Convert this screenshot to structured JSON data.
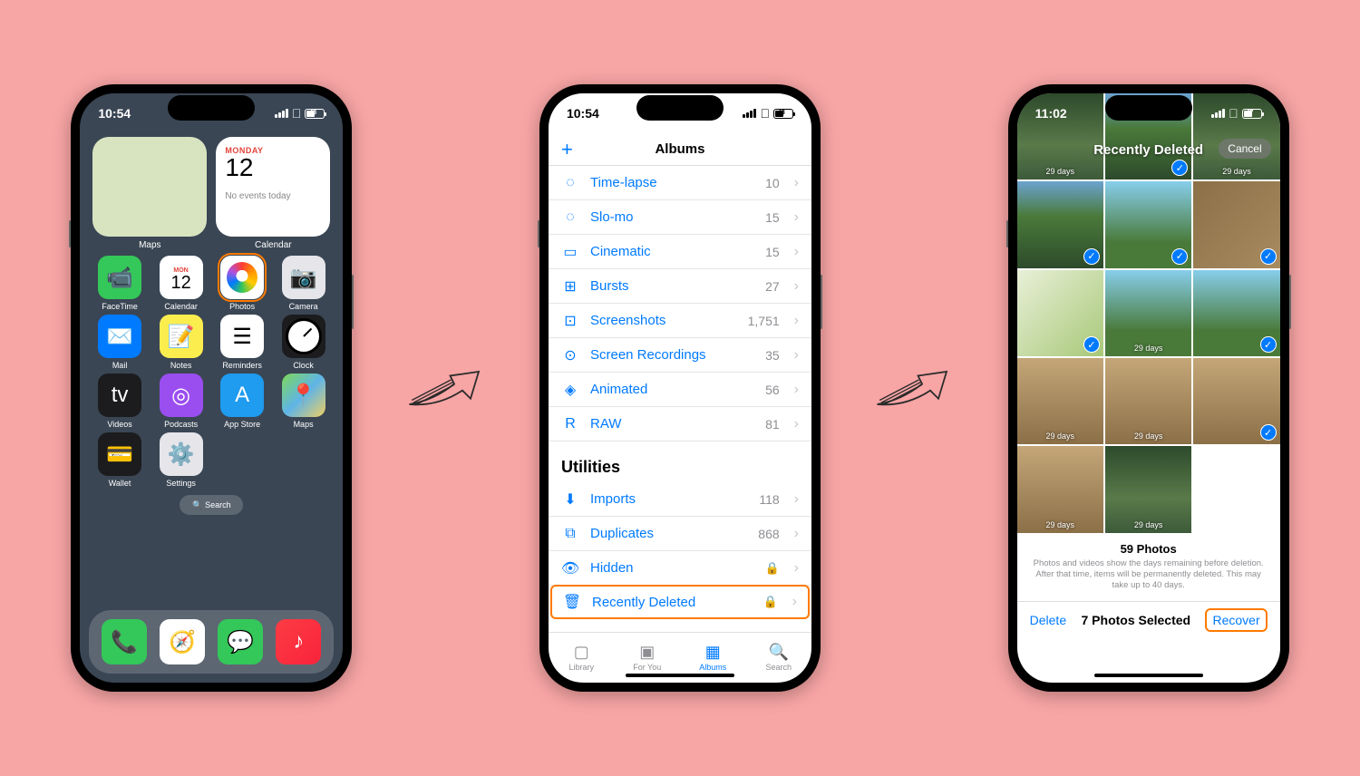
{
  "phone1": {
    "time": "10:54",
    "battery": "48",
    "widget_maps_label": "Maps",
    "widget_cal_label": "Calendar",
    "cal_day": "MONDAY",
    "cal_date": "12",
    "cal_note": "No events today",
    "apps_row1": [
      "FaceTime",
      "Calendar",
      "Photos",
      "Camera"
    ],
    "apps_row2": [
      "Mail",
      "Notes",
      "Reminders",
      "Clock"
    ],
    "apps_row3": [
      "Videos",
      "Podcasts",
      "App Store",
      "Maps"
    ],
    "apps_row4": [
      "Wallet",
      "Settings"
    ],
    "cal_mini_day": "MON",
    "cal_mini_date": "12",
    "search_label": "Search"
  },
  "phone2": {
    "time": "10:54",
    "battery": "48",
    "header_title": "Albums",
    "media_types": [
      {
        "icon": "timelapse",
        "label": "Time-lapse",
        "count": "10"
      },
      {
        "icon": "slomo",
        "label": "Slo-mo",
        "count": "15"
      },
      {
        "icon": "cinematic",
        "label": "Cinematic",
        "count": "15"
      },
      {
        "icon": "bursts",
        "label": "Bursts",
        "count": "27"
      },
      {
        "icon": "screenshots",
        "label": "Screenshots",
        "count": "1,751"
      },
      {
        "icon": "screenrec",
        "label": "Screen Recordings",
        "count": "35"
      },
      {
        "icon": "animated",
        "label": "Animated",
        "count": "56"
      },
      {
        "icon": "raw",
        "label": "RAW",
        "count": "81"
      }
    ],
    "section_utilities": "Utilities",
    "utilities": [
      {
        "icon": "imports",
        "label": "Imports",
        "count": "118",
        "lock": false
      },
      {
        "icon": "duplicates",
        "label": "Duplicates",
        "count": "868",
        "lock": false
      },
      {
        "icon": "hidden",
        "label": "Hidden",
        "count": "",
        "lock": true
      },
      {
        "icon": "trash",
        "label": "Recently Deleted",
        "count": "",
        "lock": true,
        "highlight": true
      }
    ],
    "tabs": [
      "Library",
      "For You",
      "Albums",
      "Search"
    ]
  },
  "phone3": {
    "time": "11:02",
    "battery": "47",
    "title": "Recently Deleted",
    "cancel": "Cancel",
    "days_label": "29 days",
    "info_title": "59 Photos",
    "info_sub": "Photos and videos show the days remaining before deletion. After that time, items will be permanently deleted. This may take up to 40 days.",
    "delete_btn": "Delete",
    "selected_text": "7 Photos Selected",
    "recover_btn": "Recover"
  }
}
